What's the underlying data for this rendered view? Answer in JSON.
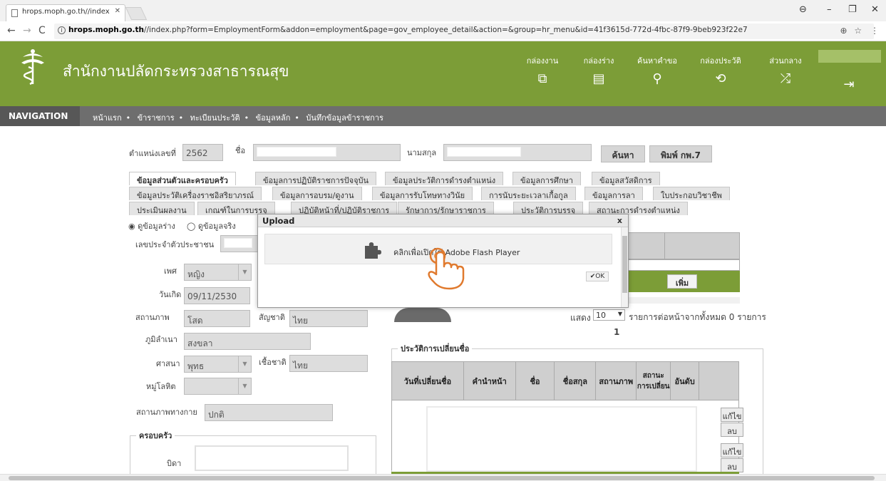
{
  "browser": {
    "tab_title": "hrops.moph.go.th//index",
    "url_host": "hrops.moph.go.th",
    "url_rest": "//index.php?form=EmploymentForm&addon=employment&page=gov_employee_detail&action=&group=hr_menu&id=41f3615d-772d-4fbc-87f9-9beb923f22e7"
  },
  "header": {
    "title": "สำนักงานปลัดกระทรวงสาธารณสุข",
    "menu": [
      {
        "label": "กล่องงาน",
        "icon": "window-icon",
        "glyph": "⧉"
      },
      {
        "label": "กล่องร่าง",
        "icon": "document-icon",
        "glyph": "▤"
      },
      {
        "label": "ค้นหาคำขอ",
        "icon": "search-icon",
        "glyph": "⚲"
      },
      {
        "label": "กล่องประวัติ",
        "icon": "history-icon",
        "glyph": "⟲"
      },
      {
        "label": "ส่วนกลาง",
        "icon": "shuffle-icon",
        "glyph": "⤮"
      }
    ],
    "logout_glyph": "⇥"
  },
  "nav": {
    "title": "NAVIGATION",
    "crumbs": [
      "หน้าแรก",
      "ข้าราชการ",
      "ทะเบียนประวัติ",
      "ข้อมูลหลัก",
      "บันทึกข้อมูลข้าราชการ"
    ]
  },
  "search": {
    "position_label": "ตำแหน่งเลขที่",
    "position_value": "2562",
    "name_label": "ชื่อ",
    "surname_label": "นามสกุล",
    "search_btn": "ค้นหา",
    "print_btn": "พิมพ์ กพ.7"
  },
  "tabs": {
    "row1": [
      "ข้อมูลส่วนตัวและครอบครัว",
      "ข้อมูลการปฏิบัติราชการปัจจุบัน",
      "ข้อมูลประวัติการดำรงตำแหน่ง",
      "ข้อมูลการศึกษา",
      "ข้อมูลสวัสดิการ"
    ],
    "row2": [
      "ข้อมูลประวัติเครื่องราชอิสริยาภรณ์",
      "ข้อมูลการอบรม/ดูงาน",
      "ข้อมูลการรับโทษทางวินัย",
      "การนับระยะเวลาเกื้อกูล",
      "ข้อมูลการลา",
      "ใบประกอบวิชาชีพ"
    ],
    "row3": [
      "ประเมินผลงาน",
      "เกณฑ์ในการบรรจุ",
      "ปฏิบัติหน้าที่/ปฏิบัติราชการ",
      "รักษาการ/รักษาราชการ",
      "ประวัติการบรรจุ",
      "สถานะการดำรงตำแหน่ง"
    ]
  },
  "radio": {
    "draft": "ดูข้อมูลร่าง",
    "real": "ดูข้อมูลจริง"
  },
  "form": {
    "id_label": "เลขประจำตัวประชาชน",
    "gender_label": "เพศ",
    "gender_value": "หญิง",
    "birth_label": "วันเกิด",
    "birth_value": "09/11/2530",
    "status_label": "สถานภาพ",
    "status_value": "โสด",
    "nationality_label": "สัญชาติ",
    "nationality_value": "ไทย",
    "hometown_label": "ภูมิลำเนา",
    "hometown_value": "สงขลา",
    "religion_label": "ศาสนา",
    "religion_value": "พุทธ",
    "race_label": "เชื้อชาติ",
    "race_value": "ไทย",
    "blood_label": "หมู่โลหิต",
    "military_label": "สถานภาพทางกาย",
    "military_value": "ปกติ",
    "family_legend": "ครอบครัว",
    "father_label": "บิดา"
  },
  "modal": {
    "title": "Upload",
    "close": "x",
    "flash_text": "คลิกเพื่อเปิดใช้ Adobe Flash Player",
    "ok": "OK"
  },
  "right_panel": {
    "add_btn": "เพิ่ม",
    "show_label": "แสดง",
    "page_size": "10",
    "page_info": "รายการต่อหน้าจากทั้งหมด 0 รายการ",
    "page_number": "1",
    "history_legend": "ประวัติการเปลี่ยนชื่อ",
    "columns": [
      "วันที่เปลี่ยนชื่อ",
      "คำนำหน้า",
      "ชื่อ",
      "ชื่อสกุล",
      "สถานภาพ",
      "สถานะการเปลี่ยน",
      "อันดับ"
    ],
    "edit_btn": "แก้ไข",
    "delete_btn": "ลบ"
  },
  "colors": {
    "header": "#7c9d37",
    "nav": "#6e6e6e"
  }
}
